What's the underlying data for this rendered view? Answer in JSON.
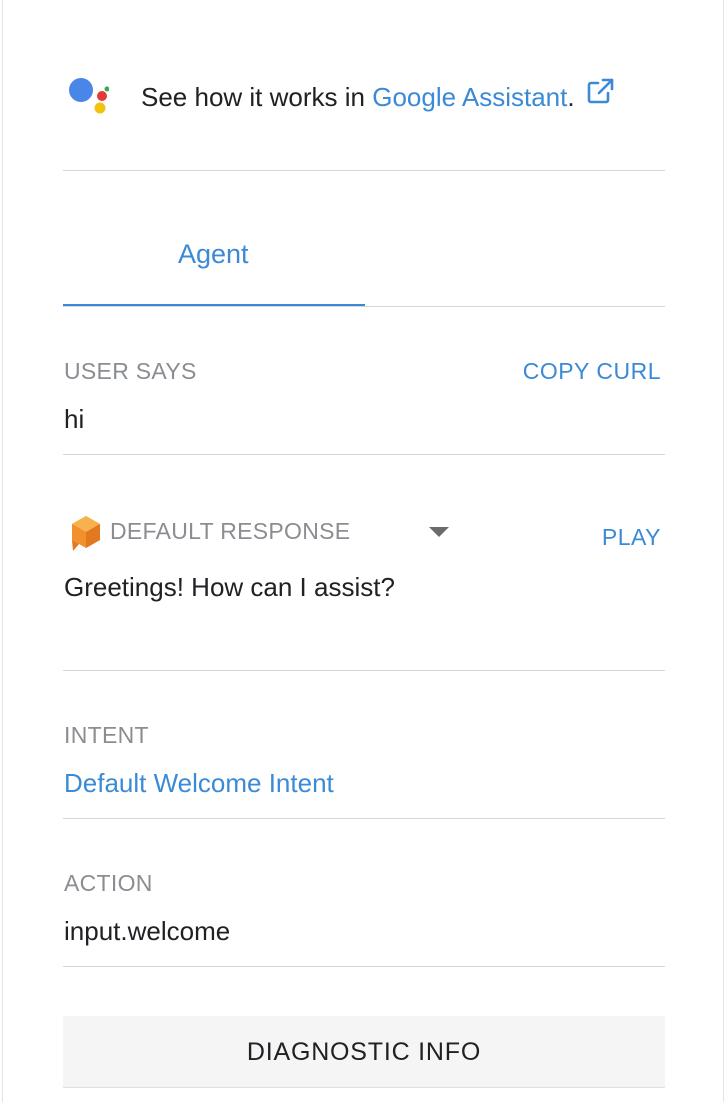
{
  "header": {
    "prefix_text": "See how it works in ",
    "link_text": "Google Assistant",
    "suffix_text": ".",
    "logo_icon": "google-assistant-logo-icon",
    "external_icon": "external-link-icon"
  },
  "tabs": [
    {
      "label": "Agent",
      "active": true
    }
  ],
  "user_says": {
    "label": "USER SAYS",
    "action_label": "COPY CURL",
    "value": "hi"
  },
  "response": {
    "icon": "dialogflow-agent-icon",
    "label": "DEFAULT RESPONSE",
    "caret_icon": "chevron-down-icon",
    "action_label": "PLAY",
    "value": "Greetings! How can I assist?"
  },
  "intent": {
    "label": "INTENT",
    "value": "Default Welcome Intent"
  },
  "action": {
    "label": "ACTION",
    "value": "input.welcome"
  },
  "diagnostic": {
    "label": "DIAGNOSTIC INFO"
  },
  "colors": {
    "accent": "#3b8ad6",
    "muted_label": "#8a8d91",
    "divider": "#d6d6d6",
    "button_bg": "#f5f5f5"
  }
}
